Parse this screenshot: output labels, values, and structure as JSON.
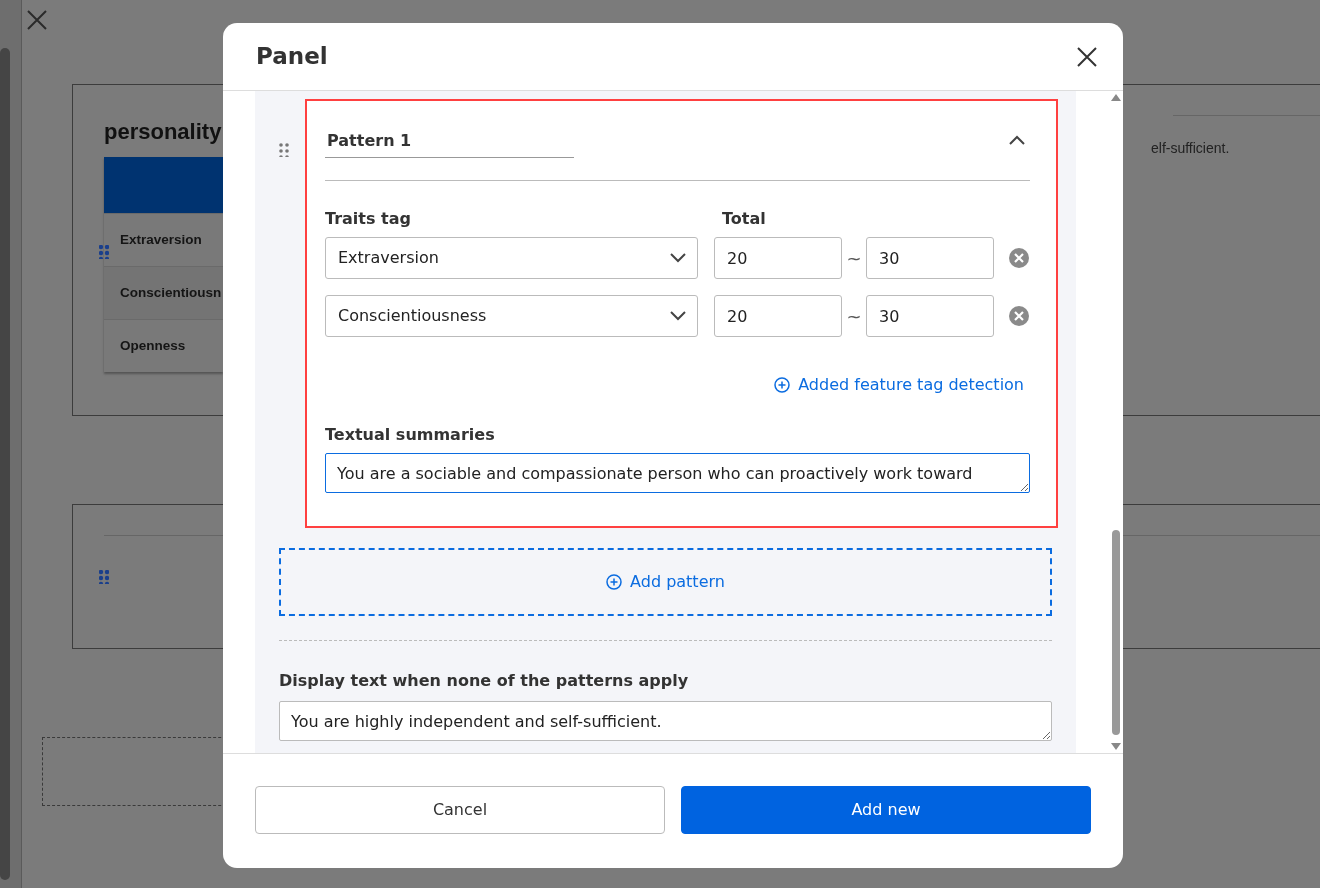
{
  "background": {
    "title": "personality",
    "table_rows": [
      "Extraversion",
      "Conscientiousn",
      "Openness"
    ],
    "side_text": "elf-sufficient."
  },
  "modal": {
    "title": "Panel",
    "patterns": [
      {
        "name": "Pattern 1",
        "expanded": true,
        "traits_label": "Traits tag",
        "total_label": "Total",
        "traits": [
          {
            "tag": "Extraversion",
            "min": "20",
            "separator": "~",
            "max": "30"
          },
          {
            "tag": "Conscientiousness",
            "min": "20",
            "separator": "~",
            "max": "30"
          }
        ],
        "add_trait_link": "Added feature tag detection",
        "summary_label": "Textual summaries",
        "summary": "You are a sociable and compassionate person who can proactively work toward"
      }
    ],
    "add_pattern": "Add pattern",
    "fallback_label": "Display text when none of the patterns apply",
    "fallback": "You are highly independent and self-sufficient.",
    "buttons": [
      {
        "label": "Cancel",
        "kind": "secondary"
      },
      {
        "label": "Add new",
        "kind": "primary"
      }
    ]
  }
}
